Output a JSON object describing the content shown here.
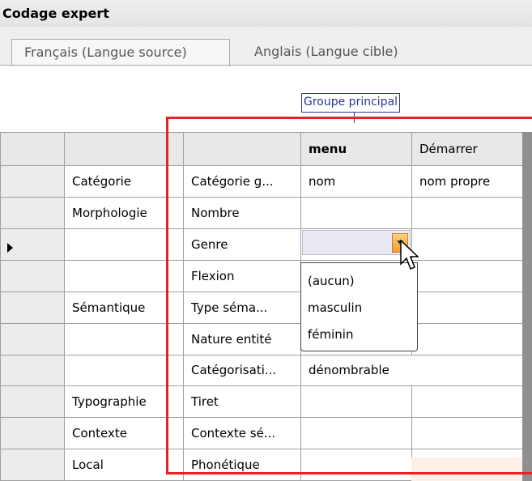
{
  "window": {
    "title": "Codage expert"
  },
  "tabs": [
    {
      "label": "Français (Langue source)",
      "active": true
    },
    {
      "label": "Anglais (Langue cible)",
      "active": false
    }
  ],
  "group_label": "Groupe principal",
  "grid": {
    "header": [
      "",
      "",
      "",
      "menu",
      "Démarrer"
    ],
    "rows": [
      {
        "group": "Catégorie",
        "prop": "Catégorie g...",
        "v1": "nom",
        "v2": "nom propre"
      },
      {
        "group": "Morphologie",
        "prop": "Nombre",
        "v1": "",
        "v2": ""
      },
      {
        "group": "",
        "prop": "Genre",
        "v1": "",
        "v2": "",
        "current": true
      },
      {
        "group": "",
        "prop": "Flexion",
        "v1": "",
        "v2": ""
      },
      {
        "group": "Sémantique",
        "prop": "Type séma...",
        "v1": "",
        "v2": ""
      },
      {
        "group": "",
        "prop": "Nature entité",
        "v1": "",
        "v2": ""
      },
      {
        "group": "",
        "prop": "Catégorisati...",
        "v1": "dénombrable",
        "v2": ""
      },
      {
        "group": "Typographie",
        "prop": "Tiret",
        "v1": "",
        "v2": ""
      },
      {
        "group": "Contexte",
        "prop": "Contexte sé...",
        "v1": "",
        "v2": ""
      },
      {
        "group": "Local",
        "prop": "Phonétique",
        "v1": "",
        "v2": ""
      }
    ]
  },
  "dropdown": {
    "options": [
      "(aucun)",
      "masculin",
      "féminin"
    ]
  },
  "colors": {
    "highlight_box": "#e4222a",
    "group_label": "#2a3a8e",
    "dropdown_button": "#f39b2a"
  }
}
